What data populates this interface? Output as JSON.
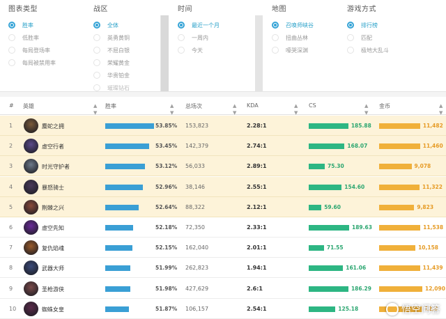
{
  "filters": [
    {
      "title": "图表类型",
      "options": [
        "胜率",
        "低胜率",
        "每局登场率",
        "每局被禁用率"
      ],
      "selected": 0
    },
    {
      "title": "战区",
      "options": [
        "全体",
        "英勇黄铜",
        "不屈白银",
        "荣耀黄金",
        "华贵铂金",
        "璀璨钻石"
      ],
      "selected": 0
    },
    {
      "title": "时间",
      "options": [
        "最近一个月",
        "一周内",
        "今天"
      ],
      "selected": 0
    },
    {
      "title": "地图",
      "options": [
        "召唤师峡谷",
        "扭曲丛林",
        "嚎哭深渊"
      ],
      "selected": 0
    },
    {
      "title": "游戏方式",
      "options": [
        "排行榜",
        "匹配",
        "极地大乱斗"
      ],
      "selected": 0
    }
  ],
  "table": {
    "headers": {
      "rank": "#",
      "hero": "英雄",
      "winrate": "胜率",
      "games": "总场次",
      "kda": "KDA",
      "cs": "CS",
      "gold": "金币"
    },
    "rows": [
      {
        "rank": "1",
        "hero": "麋蛇之拥",
        "winrate": "53.85%",
        "winrate_v": 53.85,
        "games": "153,823",
        "kda": "2.28:1",
        "cs": "185.88",
        "cs_v": 185.88,
        "gold": "11,482",
        "gold_v": 11482,
        "highlight": true,
        "avatar_color": "#7a5a3a"
      },
      {
        "rank": "2",
        "hero": "虚空行者",
        "winrate": "53.45%",
        "winrate_v": 53.45,
        "games": "142,379",
        "kda": "2.74:1",
        "cs": "168.07",
        "cs_v": 168.07,
        "gold": "11,460",
        "gold_v": 11460,
        "highlight": true,
        "avatar_color": "#5b4a8a"
      },
      {
        "rank": "3",
        "hero": "时光守护者",
        "winrate": "53.12%",
        "winrate_v": 53.12,
        "games": "56,033",
        "kda": "2.89:1",
        "cs": "75.30",
        "cs_v": 75.3,
        "gold": "9,078",
        "gold_v": 9078,
        "highlight": true,
        "avatar_color": "#6d7a8a"
      },
      {
        "rank": "4",
        "hero": "暴怒骑士",
        "winrate": "52.96%",
        "winrate_v": 52.96,
        "games": "38,146",
        "kda": "2.55:1",
        "cs": "154.60",
        "cs_v": 154.6,
        "gold": "11,322",
        "gold_v": 11322,
        "highlight": true,
        "avatar_color": "#4a3a5a"
      },
      {
        "rank": "5",
        "hero": "荆棘之兴",
        "winrate": "52.64%",
        "winrate_v": 52.64,
        "games": "88,322",
        "kda": "2.12:1",
        "cs": "59.60",
        "cs_v": 59.6,
        "gold": "9,823",
        "gold_v": 9823,
        "highlight": true,
        "avatar_color": "#8a4a3a"
      },
      {
        "rank": "6",
        "hero": "虚空先知",
        "winrate": "52.18%",
        "winrate_v": 52.18,
        "games": "72,350",
        "kda": "2.33:1",
        "cs": "189.63",
        "cs_v": 189.63,
        "gold": "11,538",
        "gold_v": 11538,
        "highlight": false,
        "avatar_color": "#6a2a9a"
      },
      {
        "rank": "7",
        "hero": "复仇焰魂",
        "winrate": "52.15%",
        "winrate_v": 52.15,
        "games": "162,040",
        "kda": "2.01:1",
        "cs": "71.55",
        "cs_v": 71.55,
        "gold": "10,158",
        "gold_v": 10158,
        "highlight": false,
        "avatar_color": "#9a5a2a"
      },
      {
        "rank": "8",
        "hero": "武器大师",
        "winrate": "51.99%",
        "winrate_v": 51.99,
        "games": "262,823",
        "kda": "1.94:1",
        "cs": "161.06",
        "cs_v": 161.06,
        "gold": "11,439",
        "gold_v": 11439,
        "highlight": false,
        "avatar_color": "#3a4a7a"
      },
      {
        "rank": "9",
        "hero": "圣枪游侠",
        "winrate": "51.98%",
        "winrate_v": 51.98,
        "games": "427,629",
        "kda": "2.6:1",
        "cs": "186.29",
        "cs_v": 186.29,
        "gold": "12,090",
        "gold_v": 12090,
        "highlight": false,
        "avatar_color": "#7a4a4a"
      },
      {
        "rank": "10",
        "hero": "蜘蛛女皇",
        "winrate": "51.87%",
        "winrate_v": 51.87,
        "games": "106,157",
        "kda": "2.54:1",
        "cs": "125.18",
        "cs_v": 125.18,
        "gold": "12,0",
        "gold_v": 12000,
        "highlight": false,
        "avatar_color": "#5a2a4a"
      }
    ]
  },
  "watermark": {
    "text": "悟空问答"
  },
  "colors": {
    "accent": "#35a3d6",
    "winrate_bar": "#3a9fd5",
    "cs_bar": "#2db683",
    "gold_bar": "#f0b03a",
    "highlight_row": "#fdf3d9"
  },
  "icons": {
    "sort": "sort-updown-icon",
    "radio": "radio-icon"
  }
}
